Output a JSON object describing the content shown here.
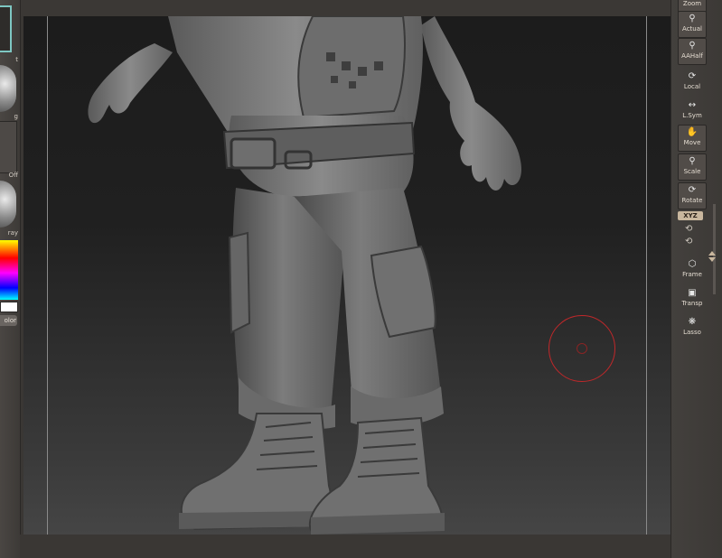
{
  "left_shelf": {
    "labels": [
      "t",
      "g",
      "Off",
      "ray"
    ],
    "color_button": "olor"
  },
  "right_shelf": {
    "tools": [
      {
        "label": "Zoom"
      },
      {
        "label": "Actual"
      },
      {
        "label": "AAHalf"
      },
      {
        "label": "Local"
      },
      {
        "label": "L.Sym"
      },
      {
        "label": "Move"
      },
      {
        "label": "Scale"
      },
      {
        "label": "Rotate"
      },
      {
        "label": "Frame"
      },
      {
        "label": "Transp"
      },
      {
        "label": "Lasso"
      }
    ],
    "xyz_toggle": "XYZ"
  },
  "colors": {
    "accent": "#c9b79e",
    "brush_ring": "#c0282a",
    "frame_highlight": "#7ec7c2"
  }
}
